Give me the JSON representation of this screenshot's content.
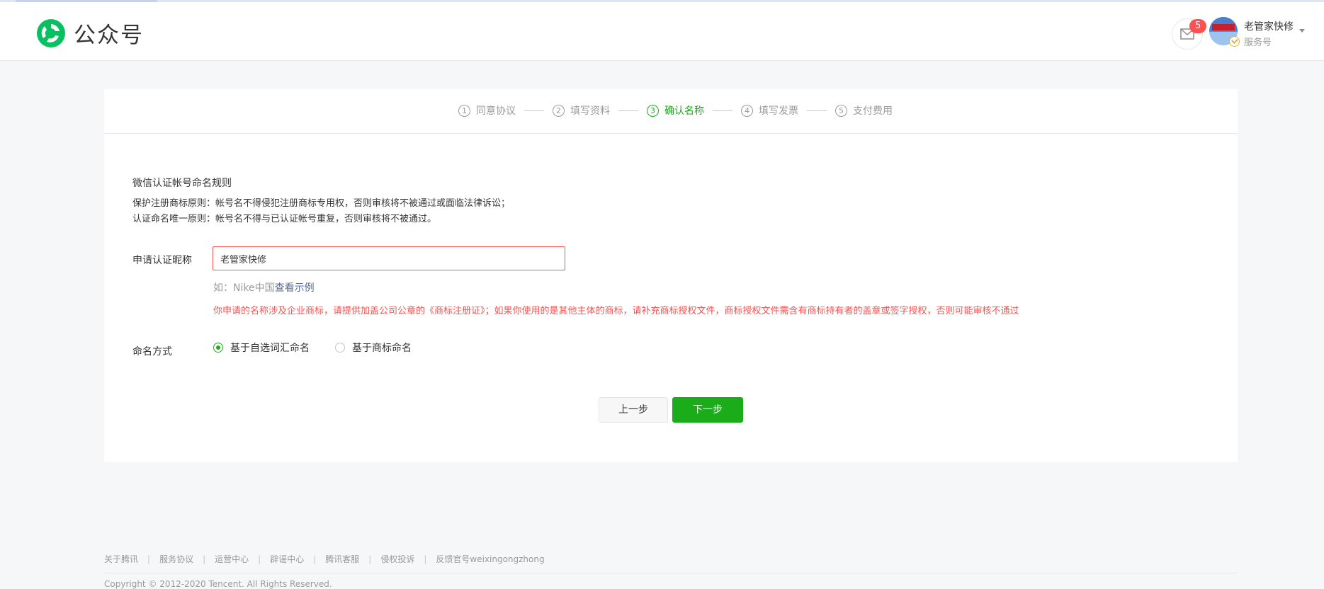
{
  "header": {
    "logo_text": "公众号",
    "message_count": "5",
    "account_name": "老管家快修",
    "account_type": "服务号"
  },
  "steps": [
    {
      "num": "1",
      "label": "同意协议",
      "active": false
    },
    {
      "num": "2",
      "label": "填写资料",
      "active": false
    },
    {
      "num": "3",
      "label": "确认名称",
      "active": true
    },
    {
      "num": "4",
      "label": "填写发票",
      "active": false
    },
    {
      "num": "5",
      "label": "支付费用",
      "active": false
    }
  ],
  "rules": {
    "title": "微信认证帐号命名规则",
    "line1": "保护注册商标原则：帐号名不得侵犯注册商标专用权，否则审核将不被通过或面临法律诉讼；",
    "line2": "认证命名唯一原则：帐号名不得与已认证帐号重复，否则审核将不被通过。"
  },
  "form": {
    "nickname_label": "申请认证昵称",
    "nickname_value": "老管家快修",
    "hint_prefix": "如：Nike中国",
    "hint_link": "查看示例",
    "error": "你申请的名称涉及企业商标，请提供加盖公司公章的《商标注册证》；如果你使用的是其他主体的商标，请补充商标授权文件，商标授权文件需含有商标持有者的盖章或签字授权，否则可能审核不通过",
    "naming_label": "命名方式",
    "option_vocab": "基于自选词汇命名",
    "option_trademark": "基于商标命名",
    "selected": "vocab"
  },
  "buttons": {
    "prev": "上一步",
    "next": "下一步"
  },
  "footer": {
    "links": [
      "关于腾讯",
      "服务协议",
      "运营中心",
      "辟谣中心",
      "腾讯客服",
      "侵权投诉",
      "反馈官号weixingongzhong"
    ],
    "copyright": "Copyright © 2012-2020 Tencent. All Rights Reserved."
  },
  "colors": {
    "brand_green": "#1aad19",
    "error_red": "#fa5151",
    "link_blue": "#576b95"
  }
}
